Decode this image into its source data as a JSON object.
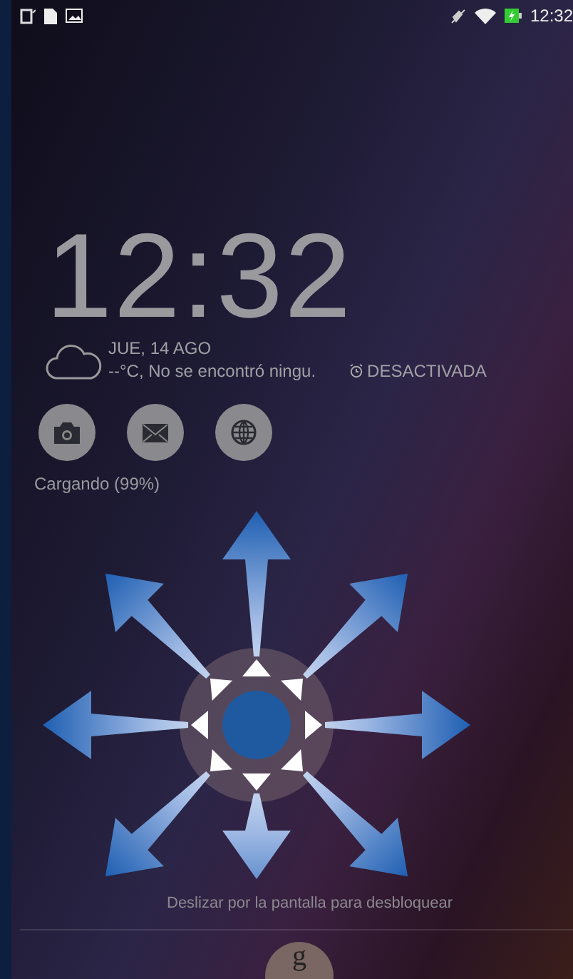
{
  "status_bar": {
    "time": "12:32"
  },
  "clock": {
    "time": "12:32",
    "date": "JUE, 14 AGO",
    "weather": "--°C, No se encontró ningu.",
    "alarm": "DESACTIVADA"
  },
  "shortcuts": [
    {
      "kind": "camera"
    },
    {
      "kind": "mail"
    },
    {
      "kind": "browser"
    }
  ],
  "charging": "Cargando (99%)",
  "unlock_hint": "Deslizar por la pantalla para desbloquear",
  "google_button": "g"
}
